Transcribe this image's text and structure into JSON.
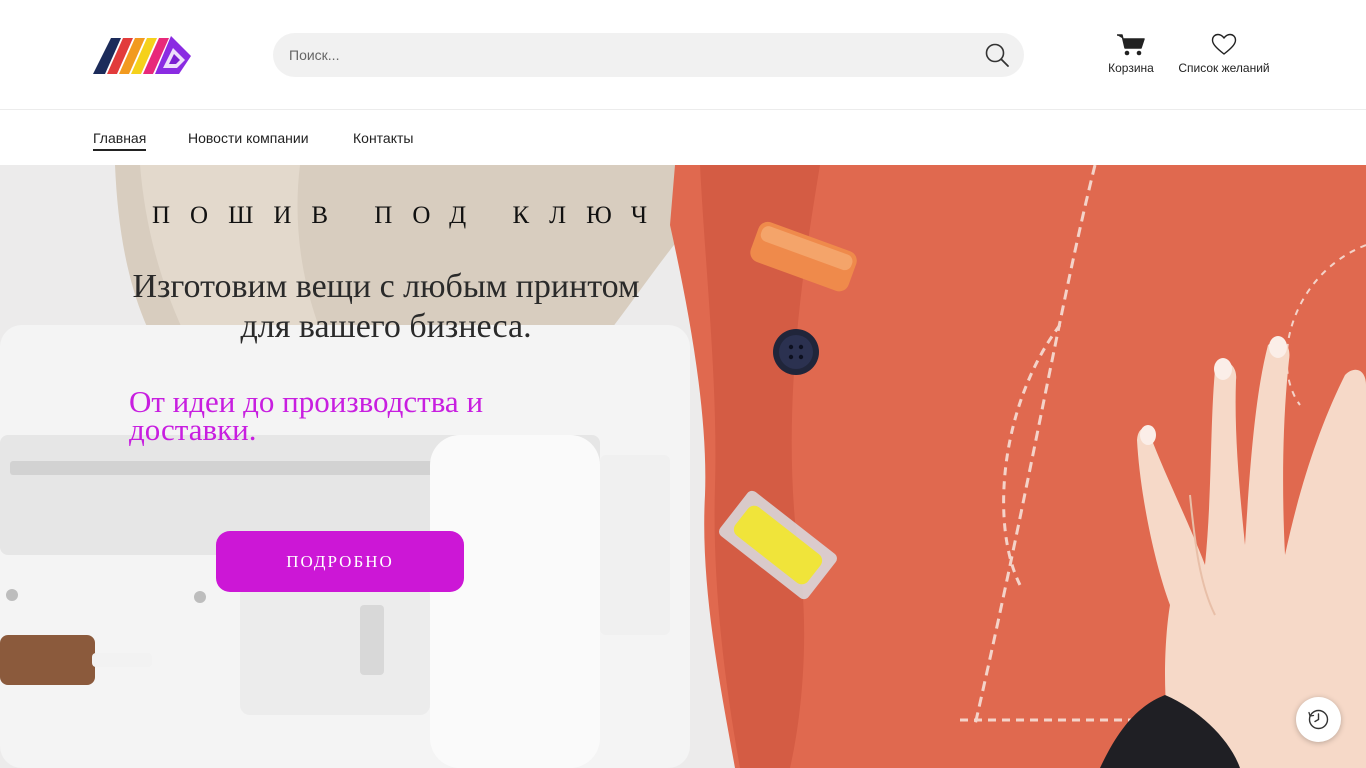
{
  "header": {
    "logo_alt": "ЖМА",
    "search": {
      "placeholder": "Поиск...",
      "value": ""
    },
    "cart_label": "Корзина",
    "wishlist_label": "Список желаний"
  },
  "nav": {
    "items": [
      {
        "label": "Главная",
        "active": true
      },
      {
        "label": "Новости компании",
        "active": false
      },
      {
        "label": "Контакты",
        "active": false
      }
    ]
  },
  "hero": {
    "eyebrow": "пошив под ключ",
    "headline": "Изготовим вещи с любым принтом для вашего бизнеса.",
    "subline": "От идеи до производства и доставки.",
    "cta_label": "подробно"
  },
  "colors": {
    "accent": "#cc17d6",
    "subline": "#c81ee0",
    "fabric": "#e0694f"
  },
  "icons": {
    "search": "search-icon",
    "cart": "cart-icon",
    "wishlist": "heart-icon",
    "history": "clock-icon"
  }
}
